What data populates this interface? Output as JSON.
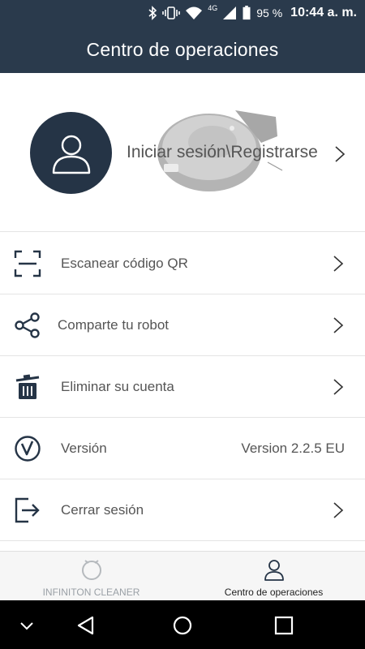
{
  "status_bar": {
    "network": "4G",
    "battery": "95 %",
    "time": "10:44 a. m."
  },
  "header": {
    "title": "Centro de operaciones"
  },
  "profile": {
    "login_label": "Iniciar sesión\\Registrarse"
  },
  "menu": {
    "items": [
      {
        "label": "Escanear código QR",
        "icon": "qr-scan-icon"
      },
      {
        "label": "Comparte tu robot",
        "icon": "share-icon"
      },
      {
        "label": "Eliminar su cuenta",
        "icon": "trash-icon"
      },
      {
        "label": "Versión",
        "icon": "version-icon",
        "value": "Version 2.2.5 EU"
      },
      {
        "label": "Cerrar sesión",
        "icon": "logout-icon"
      }
    ]
  },
  "bottom_nav": {
    "tabs": [
      {
        "label": "INFINITON CLEANER",
        "icon": "robot-icon",
        "active": false
      },
      {
        "label": "Centro de operaciones",
        "icon": "user-icon",
        "active": true
      }
    ]
  },
  "colors": {
    "header_bg": "#2a3a4c",
    "avatar_bg": "#253446",
    "icon_dark": "#253446",
    "text": "#555555",
    "divider": "#e4e4e4"
  }
}
